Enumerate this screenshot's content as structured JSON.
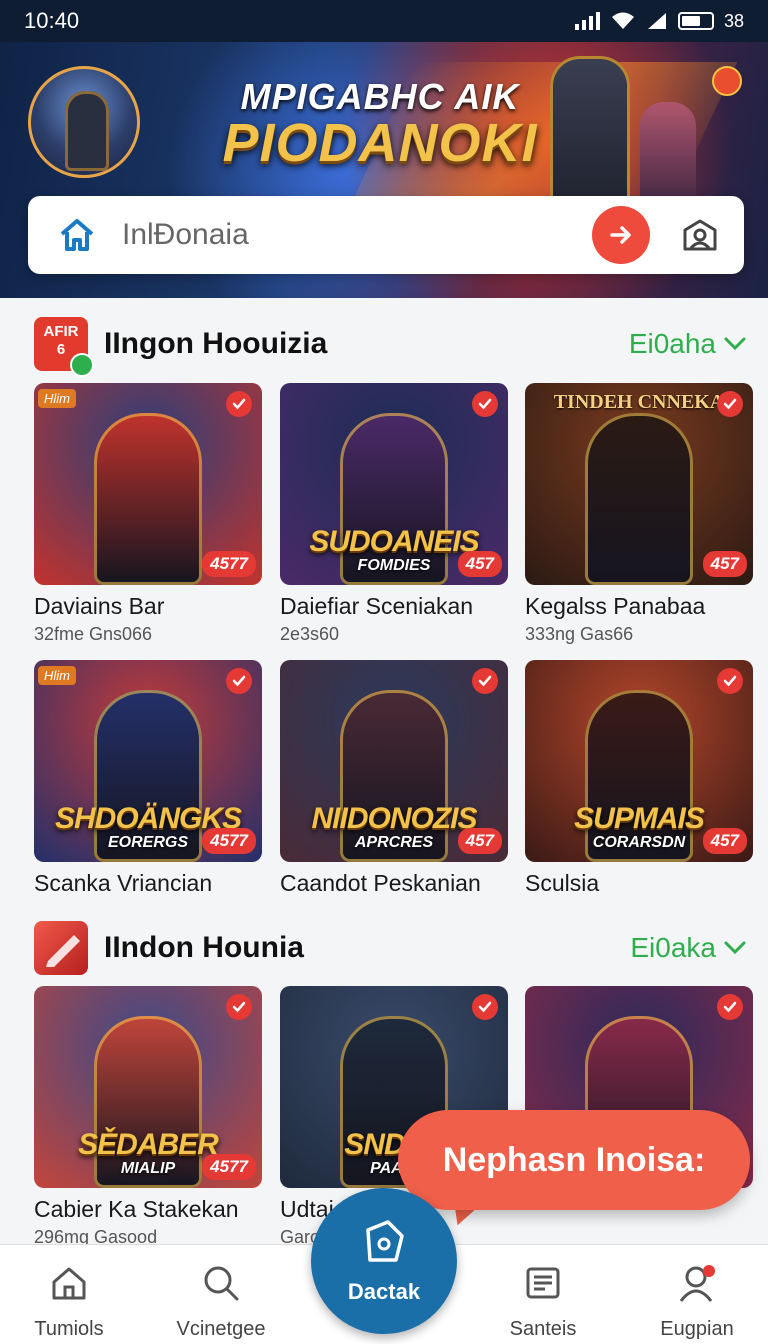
{
  "status_bar": {
    "time": "10:40",
    "battery": "38"
  },
  "hero": {
    "line1": "MPIGABHC AIK",
    "line2": "PIODANOKI"
  },
  "search": {
    "placeholder": "InlĐonaia"
  },
  "sections": [
    {
      "icon_label": "AFIR 6",
      "title": "IIngon Hoouizia",
      "link": "Ei0aha",
      "cards": [
        {
          "title": "Daviains Bar",
          "sub": "32fme Gns066",
          "rating": "4577",
          "corner": "Hlim",
          "logo": "",
          "logo_sub": "",
          "top_title": "",
          "colors": [
            "#2a3f7a",
            "#c2332d"
          ]
        },
        {
          "title": "Daiefiar Sceniakan",
          "sub": "2e3s60",
          "rating": "457",
          "corner": "",
          "logo": "SUDOANEIS",
          "logo_sub": "FOMDIES",
          "top_title": "",
          "colors": [
            "#1c2d55",
            "#4b2a68"
          ]
        },
        {
          "title": "Kegalss Panabaa",
          "sub": "333ng Gas66",
          "rating": "457",
          "corner": "",
          "logo": "",
          "logo_sub": "",
          "top_title": "TINDEH CNNEKA",
          "colors": [
            "#7a3a1e",
            "#2b1a14"
          ]
        },
        {
          "title": "Scanka Vriancian",
          "sub": "",
          "rating": "4577",
          "corner": "Hlim",
          "logo": "SHDOÄNGKS",
          "logo_sub": "EORERGS",
          "top_title": "",
          "colors": [
            "#c23a3a",
            "#24306a"
          ]
        },
        {
          "title": "Caandot Peskanian",
          "sub": "",
          "rating": "457",
          "corner": "",
          "logo": "NIIDONOZIS",
          "logo_sub": "APRCRES",
          "top_title": "",
          "colors": [
            "#2a3a5c",
            "#4a2a36"
          ]
        },
        {
          "title": "Sculsia",
          "sub": "",
          "rating": "457",
          "corner": "",
          "logo": "SUPMAIS",
          "logo_sub": "CORARSDN",
          "top_title": "",
          "colors": [
            "#b4462a",
            "#3a1a16"
          ]
        }
      ]
    },
    {
      "icon_label": "",
      "title": "IIndon Hounia",
      "link": "Ei0aka",
      "cards": [
        {
          "title": "Cabier Ka Stakekan",
          "sub": "296mg Gasood",
          "rating": "4577",
          "corner": "",
          "logo": "SĚDABER",
          "logo_sub": "MIALIP",
          "top_title": "",
          "colors": [
            "#3a4a8a",
            "#c2453a"
          ]
        },
        {
          "title": "Udtaian",
          "sub": "Garo",
          "rating": "",
          "corner": "",
          "logo": "SNDTO",
          "logo_sub": "PAAIS",
          "top_title": "",
          "colors": [
            "#3a4a6a",
            "#1e2a3c"
          ]
        },
        {
          "title": "",
          "sub": "",
          "rating": "",
          "corner": "",
          "logo": "",
          "logo_sub": "",
          "top_title": "",
          "colors": [
            "#2a2a5a",
            "#8a2a4a"
          ]
        }
      ]
    }
  ],
  "tooltip": "Nephasn Inoisa:",
  "nav": {
    "home": "Tumiols",
    "search": "Vcinetgee",
    "center": "Dactak",
    "list": "Santeis",
    "profile": "Eugpian"
  },
  "colors": {
    "accent": "#ef4b3c",
    "link": "#2fae4e",
    "fab": "#1a6fa8",
    "header": "#0f1d33"
  }
}
